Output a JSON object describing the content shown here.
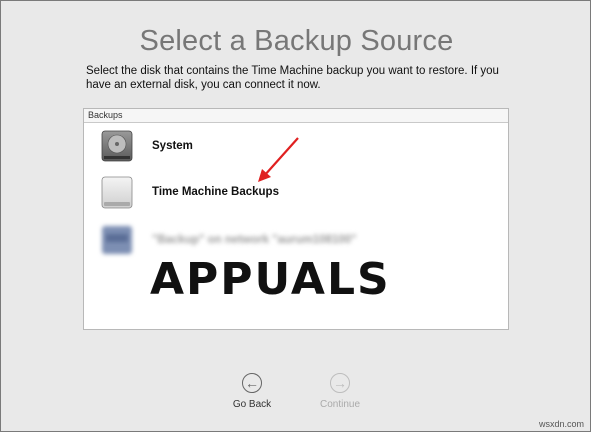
{
  "header": {
    "title": "Select a Backup Source",
    "description": "Select the disk that contains the Time Machine backup you want to restore. If you have an external disk, you can connect it now."
  },
  "panel": {
    "header_label": "Backups",
    "items": [
      {
        "label": "System",
        "icon": "internal-disk-icon"
      },
      {
        "label": "Time Machine Backups",
        "icon": "external-disk-icon"
      },
      {
        "label": "\"Backup\" on network \"aurum108100\"",
        "icon": "network-volume-icon"
      }
    ],
    "watermark": "APPUALS"
  },
  "navigation": {
    "back_label": "Go Back",
    "continue_label": "Continue"
  },
  "footer": {
    "source": "wsxdn.com"
  },
  "colors": {
    "arrow": "#e02020",
    "background": "#e9e9e9"
  }
}
